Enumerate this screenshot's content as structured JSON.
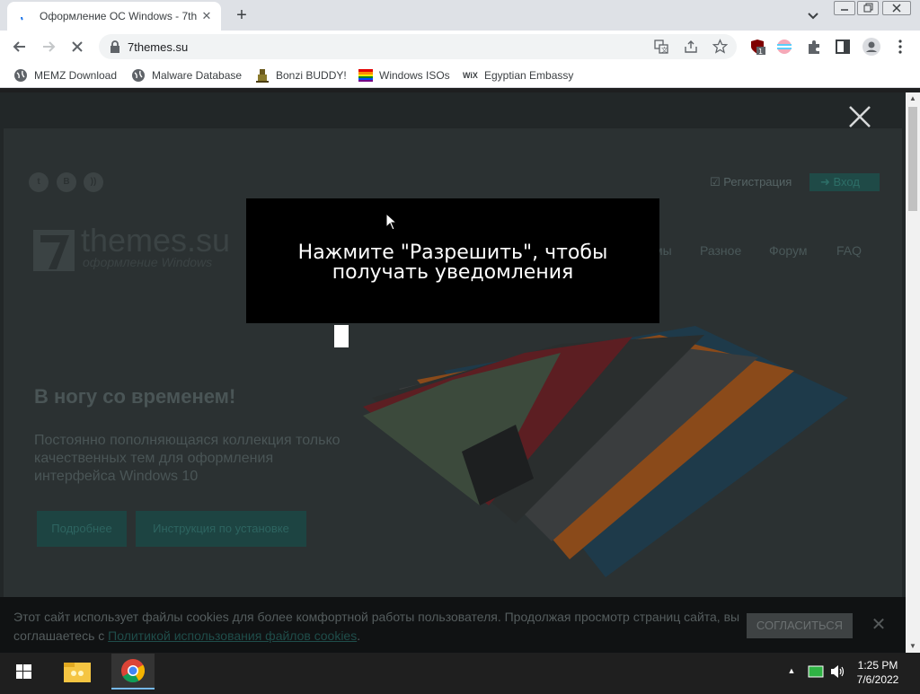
{
  "browser": {
    "tab_title": "Оформление ОС Windows - 7th",
    "url": "7themes.su",
    "extension_badge": "1",
    "bookmarks": [
      {
        "label": "MEMZ Download",
        "icon": "globe-icon"
      },
      {
        "label": "Malware Database",
        "icon": "globe-icon"
      },
      {
        "label": "Bonzi BUDDY!",
        "icon": "bonzi-icon"
      },
      {
        "label": "Windows ISOs",
        "icon": "windows-flag-icon"
      },
      {
        "label": "Egyptian Embassy",
        "icon": "wix-icon"
      }
    ],
    "wix_badge": "WiX"
  },
  "site": {
    "social": [
      "t",
      "В",
      "rss"
    ],
    "register_label": "Регистрация",
    "login_label": "Вход",
    "logo_text": "themes.su",
    "logo_sub": "оформление Windows",
    "nav": [
      "мы",
      "Разное",
      "Форум",
      "FAQ"
    ],
    "hero_title": "В ногу со временем!",
    "hero_text": "Постоянно пополняющаяся коллекция только качественных тем для оформления интерфейса Windows 10",
    "btn_more": "Подробнее",
    "btn_install": "Инструкция по установке"
  },
  "modal": {
    "line1": "Нажмите \"Разрешить\", чтобы",
    "line2": "получать уведомления"
  },
  "cookie": {
    "text": "Этот сайт использует файлы cookies для более комфортной работы пользователя. Продолжая просмотр страниц сайта, вы соглашаетесь с ",
    "link": "Политикой использования файлов cookies",
    "suffix": ".",
    "accept": "СОГЛАСИТЬСЯ"
  },
  "taskbar": {
    "time": "1:25 PM",
    "date": "7/6/2022"
  },
  "colors": {
    "modal_bg": "#000000",
    "accent_teal": "#1d4442",
    "chrome_tabstrip": "#dee1e6"
  }
}
